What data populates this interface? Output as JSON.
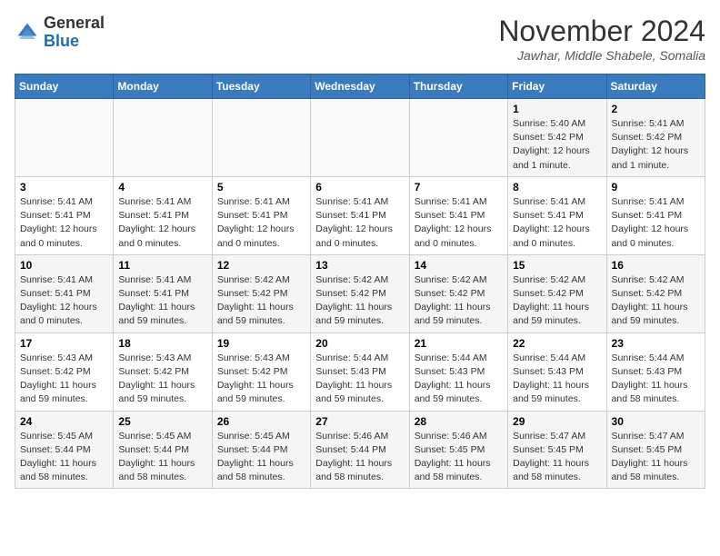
{
  "header": {
    "logo_general": "General",
    "logo_blue": "Blue",
    "month_title": "November 2024",
    "location": "Jawhar, Middle Shabele, Somalia"
  },
  "days_of_week": [
    "Sunday",
    "Monday",
    "Tuesday",
    "Wednesday",
    "Thursday",
    "Friday",
    "Saturday"
  ],
  "weeks": [
    {
      "days": [
        {
          "num": "",
          "info": ""
        },
        {
          "num": "",
          "info": ""
        },
        {
          "num": "",
          "info": ""
        },
        {
          "num": "",
          "info": ""
        },
        {
          "num": "",
          "info": ""
        },
        {
          "num": "1",
          "info": "Sunrise: 5:40 AM\nSunset: 5:42 PM\nDaylight: 12 hours\nand 1 minute."
        },
        {
          "num": "2",
          "info": "Sunrise: 5:41 AM\nSunset: 5:42 PM\nDaylight: 12 hours\nand 1 minute."
        }
      ]
    },
    {
      "days": [
        {
          "num": "3",
          "info": "Sunrise: 5:41 AM\nSunset: 5:41 PM\nDaylight: 12 hours\nand 0 minutes."
        },
        {
          "num": "4",
          "info": "Sunrise: 5:41 AM\nSunset: 5:41 PM\nDaylight: 12 hours\nand 0 minutes."
        },
        {
          "num": "5",
          "info": "Sunrise: 5:41 AM\nSunset: 5:41 PM\nDaylight: 12 hours\nand 0 minutes."
        },
        {
          "num": "6",
          "info": "Sunrise: 5:41 AM\nSunset: 5:41 PM\nDaylight: 12 hours\nand 0 minutes."
        },
        {
          "num": "7",
          "info": "Sunrise: 5:41 AM\nSunset: 5:41 PM\nDaylight: 12 hours\nand 0 minutes."
        },
        {
          "num": "8",
          "info": "Sunrise: 5:41 AM\nSunset: 5:41 PM\nDaylight: 12 hours\nand 0 minutes."
        },
        {
          "num": "9",
          "info": "Sunrise: 5:41 AM\nSunset: 5:41 PM\nDaylight: 12 hours\nand 0 minutes."
        }
      ]
    },
    {
      "days": [
        {
          "num": "10",
          "info": "Sunrise: 5:41 AM\nSunset: 5:41 PM\nDaylight: 12 hours\nand 0 minutes."
        },
        {
          "num": "11",
          "info": "Sunrise: 5:41 AM\nSunset: 5:41 PM\nDaylight: 11 hours\nand 59 minutes."
        },
        {
          "num": "12",
          "info": "Sunrise: 5:42 AM\nSunset: 5:42 PM\nDaylight: 11 hours\nand 59 minutes."
        },
        {
          "num": "13",
          "info": "Sunrise: 5:42 AM\nSunset: 5:42 PM\nDaylight: 11 hours\nand 59 minutes."
        },
        {
          "num": "14",
          "info": "Sunrise: 5:42 AM\nSunset: 5:42 PM\nDaylight: 11 hours\nand 59 minutes."
        },
        {
          "num": "15",
          "info": "Sunrise: 5:42 AM\nSunset: 5:42 PM\nDaylight: 11 hours\nand 59 minutes."
        },
        {
          "num": "16",
          "info": "Sunrise: 5:42 AM\nSunset: 5:42 PM\nDaylight: 11 hours\nand 59 minutes."
        }
      ]
    },
    {
      "days": [
        {
          "num": "17",
          "info": "Sunrise: 5:43 AM\nSunset: 5:42 PM\nDaylight: 11 hours\nand 59 minutes."
        },
        {
          "num": "18",
          "info": "Sunrise: 5:43 AM\nSunset: 5:42 PM\nDaylight: 11 hours\nand 59 minutes."
        },
        {
          "num": "19",
          "info": "Sunrise: 5:43 AM\nSunset: 5:42 PM\nDaylight: 11 hours\nand 59 minutes."
        },
        {
          "num": "20",
          "info": "Sunrise: 5:44 AM\nSunset: 5:43 PM\nDaylight: 11 hours\nand 59 minutes."
        },
        {
          "num": "21",
          "info": "Sunrise: 5:44 AM\nSunset: 5:43 PM\nDaylight: 11 hours\nand 59 minutes."
        },
        {
          "num": "22",
          "info": "Sunrise: 5:44 AM\nSunset: 5:43 PM\nDaylight: 11 hours\nand 59 minutes."
        },
        {
          "num": "23",
          "info": "Sunrise: 5:44 AM\nSunset: 5:43 PM\nDaylight: 11 hours\nand 58 minutes."
        }
      ]
    },
    {
      "days": [
        {
          "num": "24",
          "info": "Sunrise: 5:45 AM\nSunset: 5:44 PM\nDaylight: 11 hours\nand 58 minutes."
        },
        {
          "num": "25",
          "info": "Sunrise: 5:45 AM\nSunset: 5:44 PM\nDaylight: 11 hours\nand 58 minutes."
        },
        {
          "num": "26",
          "info": "Sunrise: 5:45 AM\nSunset: 5:44 PM\nDaylight: 11 hours\nand 58 minutes."
        },
        {
          "num": "27",
          "info": "Sunrise: 5:46 AM\nSunset: 5:44 PM\nDaylight: 11 hours\nand 58 minutes."
        },
        {
          "num": "28",
          "info": "Sunrise: 5:46 AM\nSunset: 5:45 PM\nDaylight: 11 hours\nand 58 minutes."
        },
        {
          "num": "29",
          "info": "Sunrise: 5:47 AM\nSunset: 5:45 PM\nDaylight: 11 hours\nand 58 minutes."
        },
        {
          "num": "30",
          "info": "Sunrise: 5:47 AM\nSunset: 5:45 PM\nDaylight: 11 hours\nand 58 minutes."
        }
      ]
    }
  ]
}
